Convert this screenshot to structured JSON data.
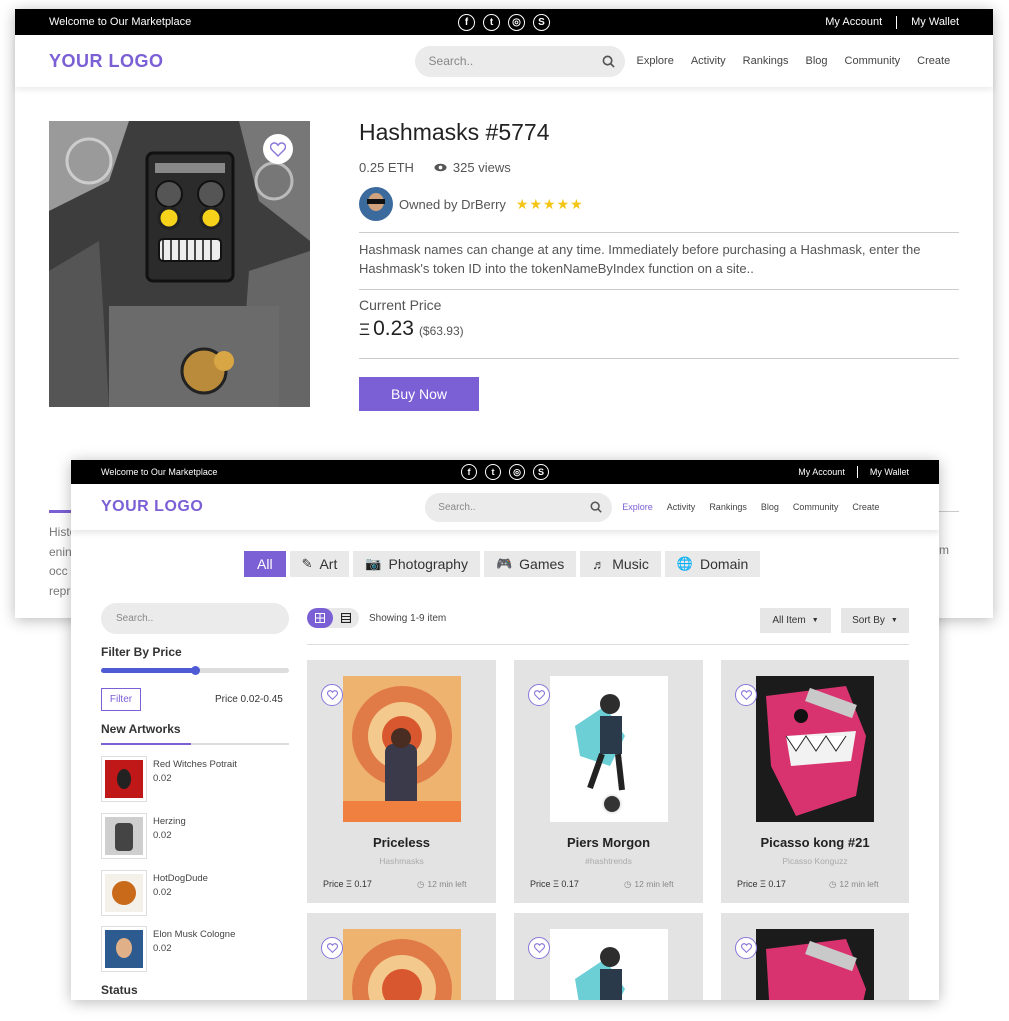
{
  "topbar": {
    "welcome": "Welcome to Our Marketplace",
    "my_account": "My Account",
    "my_wallet": "My Wallet",
    "social": [
      "f",
      "t",
      "◎",
      "S"
    ]
  },
  "navbar": {
    "logo": "YOUR LOGO",
    "search_placeholder": "Search..",
    "links": [
      "Explore",
      "Activity",
      "Rankings",
      "Blog",
      "Community",
      "Create"
    ]
  },
  "detail": {
    "title": "Hashmasks #5774",
    "price_eth": "0.25 ETH",
    "views": "325 views",
    "owned_by": "Owned by DrBerry",
    "rating": 5,
    "description": "Hashmask names can change at any time. Immediately before purchasing a Hashmask, enter the Hashmask's token ID into the tokenNameByIndex function on a site..",
    "current_price_label": "Current Price",
    "current_price": "0.23",
    "current_price_usd": "($63.93)",
    "buy_label": "Buy Now",
    "history_fragments": [
      "Histo",
      "enin",
      "occ",
      "repr"
    ],
    "right_fragment": "m"
  },
  "explore": {
    "categories": [
      {
        "label": "All",
        "icon": "",
        "active": true
      },
      {
        "label": "Art",
        "icon": "art-icon",
        "active": false
      },
      {
        "label": "Photography",
        "icon": "camera-icon",
        "active": false
      },
      {
        "label": "Games",
        "icon": "gamepad-icon",
        "active": false
      },
      {
        "label": "Music",
        "icon": "music-icon",
        "active": false
      },
      {
        "label": "Domain",
        "icon": "globe-icon",
        "active": false
      }
    ],
    "sidebar": {
      "search_placeholder": "Search..",
      "filter_title": "Filter By Price",
      "slider_value": 0.5,
      "filter_btn": "Filter",
      "price_range": "Price 0.02-0.45",
      "new_artworks_title": "New Artworks",
      "artworks": [
        {
          "name": "Red Witches Potrait",
          "price": "0.02"
        },
        {
          "name": "Herzing",
          "price": "0.02"
        },
        {
          "name": "HotDogDude",
          "price": "0.02"
        },
        {
          "name": "Elon Musk Cologne",
          "price": "0.02"
        }
      ],
      "status_title": "Status"
    },
    "toolbar": {
      "showing": "Showing 1-9 item",
      "all_item": "All Item",
      "sort_by": "Sort By"
    },
    "cards": [
      {
        "title": "Priceless",
        "sub": "Hashmasks",
        "price": "Price Ξ 0.17",
        "time": "12 min left"
      },
      {
        "title": "Piers Morgon",
        "sub": "#hashtrends",
        "price": "Price Ξ 0.17",
        "time": "12 min left"
      },
      {
        "title": "Picasso kong #21",
        "sub": "Picasso Konguzz",
        "price": "Price Ξ 0.17",
        "time": "12 min left"
      }
    ]
  }
}
